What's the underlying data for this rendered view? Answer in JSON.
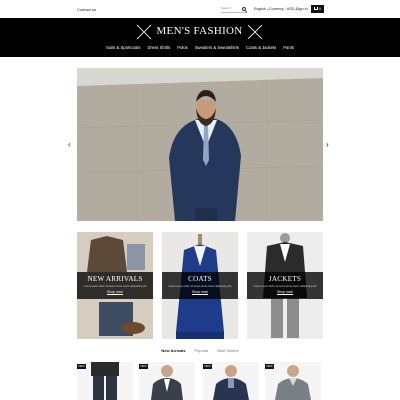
{
  "topbar": {
    "contact_label": "Contact us",
    "search_placeholder": "Search",
    "language": "English",
    "currency": "Currency : USD",
    "signin_label": "Sign in",
    "cart_count": "0"
  },
  "header": {
    "logo_text": "MEN'S FASHION",
    "nav": [
      "Suits & Sportcoats",
      "Dress Shirts",
      "Polos",
      "Sweaters & Sweatshirts",
      "Coats & Jackets",
      "Pants"
    ]
  },
  "hero": {
    "prev_arrow": "‹",
    "next_arrow": "›"
  },
  "banners": [
    {
      "title": "NEW ARRIVALS",
      "desc": "Lorem ipsum dolor sit amet conse ctetur adipisicing elit",
      "link": "Shop now!"
    },
    {
      "title": "COATS",
      "desc": "Lorem ipsum dolor sit amet conse ctetur adipisicing elit",
      "link": "Shop now!"
    },
    {
      "title": "JACKETS",
      "desc": "Lorem ipsum dolor sit amet conse ctetur adipisicing elit",
      "link": "Shop now!"
    }
  ],
  "tabs": [
    "New Arrivals",
    "Popular",
    "Best Sellers"
  ],
  "products": [
    {
      "badge": "NEW"
    },
    {
      "badge": "NEW"
    },
    {
      "badge": "NEW"
    },
    {
      "badge": "NEW"
    }
  ],
  "colors": {
    "header_bg": "#000000",
    "accent": "#111111"
  }
}
